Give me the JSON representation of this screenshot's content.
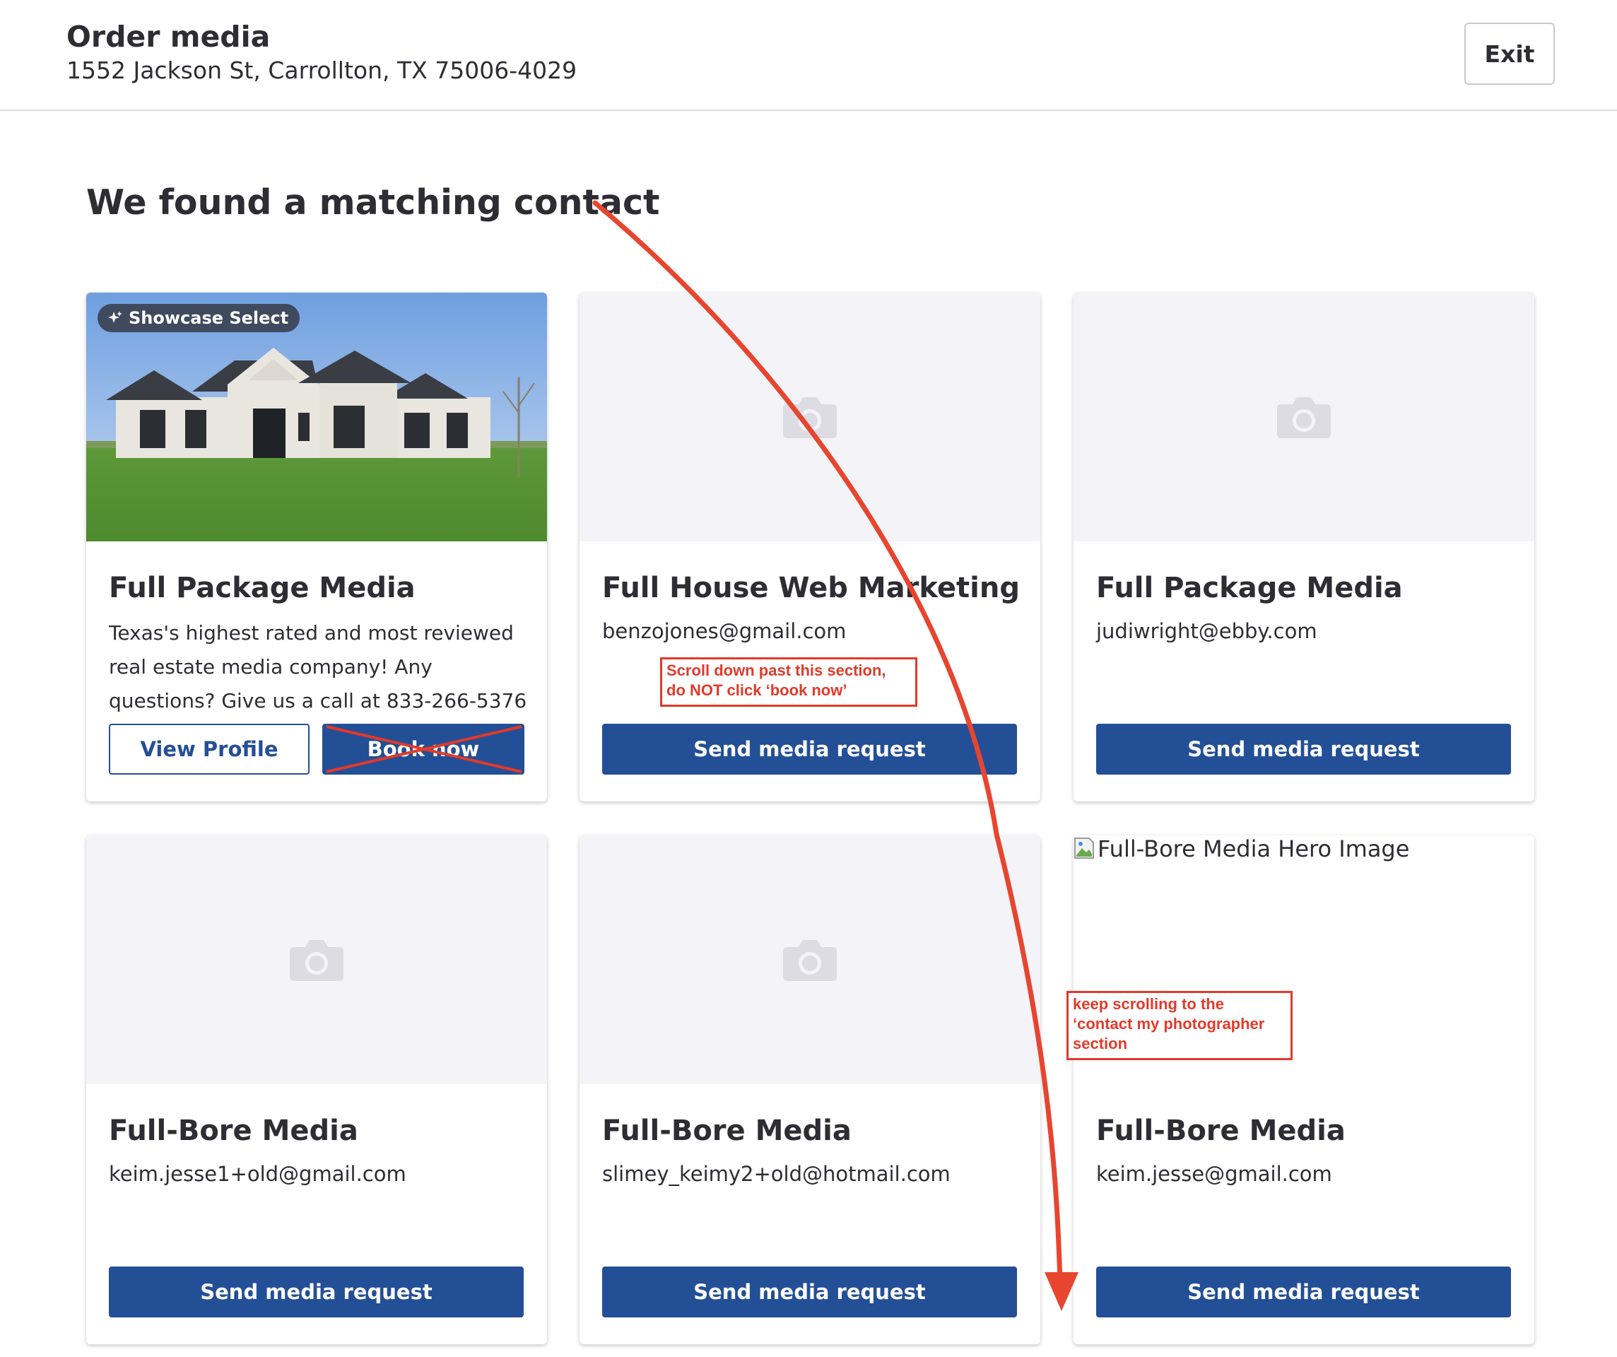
{
  "header": {
    "title": "Order media",
    "address": "1552 Jackson St, Carrollton, TX 75006-4029",
    "exit_label": "Exit"
  },
  "heading": "We found a matching contact",
  "cards": [
    {
      "badge": "Showcase Select",
      "title": "Full Package Media",
      "description": "Texas's highest rated and most reviewed real estate media company! Any questions? Give us a call at 833-266-5376",
      "view_profile_label": "View Profile",
      "book_now_label": "Book now"
    },
    {
      "title": "Full House Web Marketing",
      "email": "benzojones@gmail.com",
      "button_label": "Send media request"
    },
    {
      "title": "Full Package Media",
      "email": "judiwright@ebby.com",
      "button_label": "Send media request"
    },
    {
      "title": "Full-Bore Media",
      "email": "keim.jesse1+old@gmail.com",
      "button_label": "Send media request"
    },
    {
      "title": "Full-Bore Media",
      "email": "slimey_keimy2+old@hotmail.com",
      "button_label": "Send media request"
    },
    {
      "image_alt": "Full-Bore Media Hero Image",
      "title": "Full-Bore Media",
      "email": "keim.jesse@gmail.com",
      "button_label": "Send media request"
    }
  ],
  "annotations": {
    "note1_line1": "Scroll down past this section,",
    "note1_line2": "do NOT click ‘book now’",
    "note2_line1": "keep scrolling to the",
    "note2_line2": "‘contact my photographer",
    "note2_line3": "section"
  },
  "colors": {
    "primary": "#234f96",
    "annotation": "#e23a2a",
    "placeholder_bg": "#f4f4f8"
  },
  "icons": [
    "camera-icon",
    "sparkle-icon",
    "broken-image-icon"
  ]
}
